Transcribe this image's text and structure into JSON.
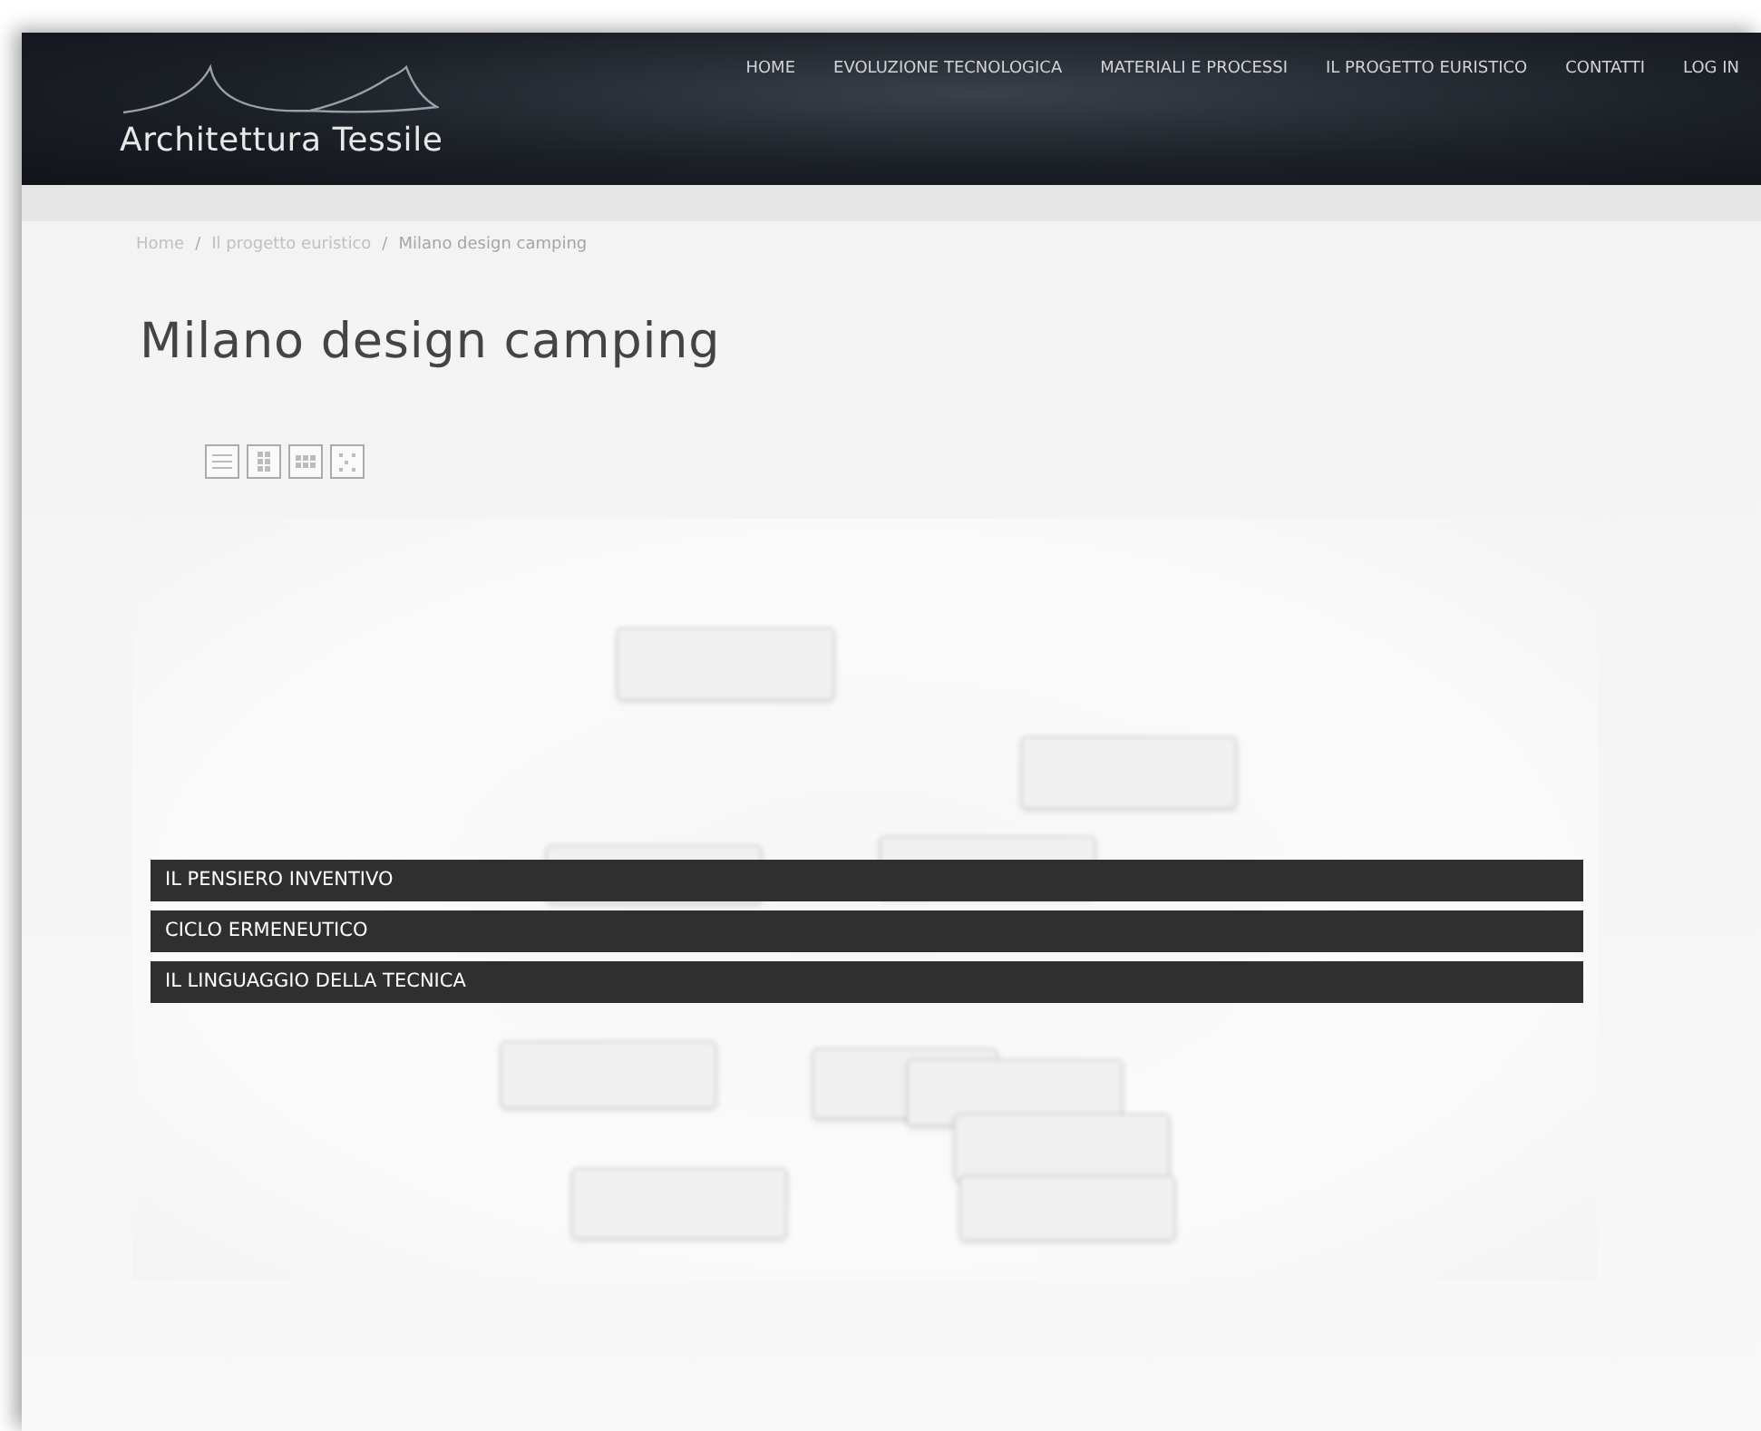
{
  "site": {
    "logo_text": "Architettura Tessile"
  },
  "nav": [
    {
      "label": "HOME"
    },
    {
      "label": "EVOLUZIONE TECNOLOGICA"
    },
    {
      "label": "MATERIALI E PROCESSI"
    },
    {
      "label": "IL PROGETTO EURISTICO"
    },
    {
      "label": "CONTATTI"
    },
    {
      "label": "LOG IN"
    }
  ],
  "breadcrumb": [
    {
      "kind": "link",
      "label": "Home"
    },
    {
      "kind": "separator",
      "label": "/"
    },
    {
      "kind": "link",
      "label": "Il progetto euristico"
    },
    {
      "kind": "separator",
      "label": "/"
    },
    {
      "kind": "current",
      "label": "Milano design camping"
    }
  ],
  "page_title": "Milano design camping",
  "view_modes": [
    {
      "kind": "list"
    },
    {
      "kind": "grid"
    },
    {
      "kind": "rows"
    },
    {
      "kind": "scatter"
    }
  ],
  "categories": [
    {
      "label": "IL PENSIERO INVENTIVO"
    },
    {
      "label": "CICLO ERMENEUTICO"
    },
    {
      "label": "IL LINGUAGGIO DELLA TECNICA"
    }
  ]
}
